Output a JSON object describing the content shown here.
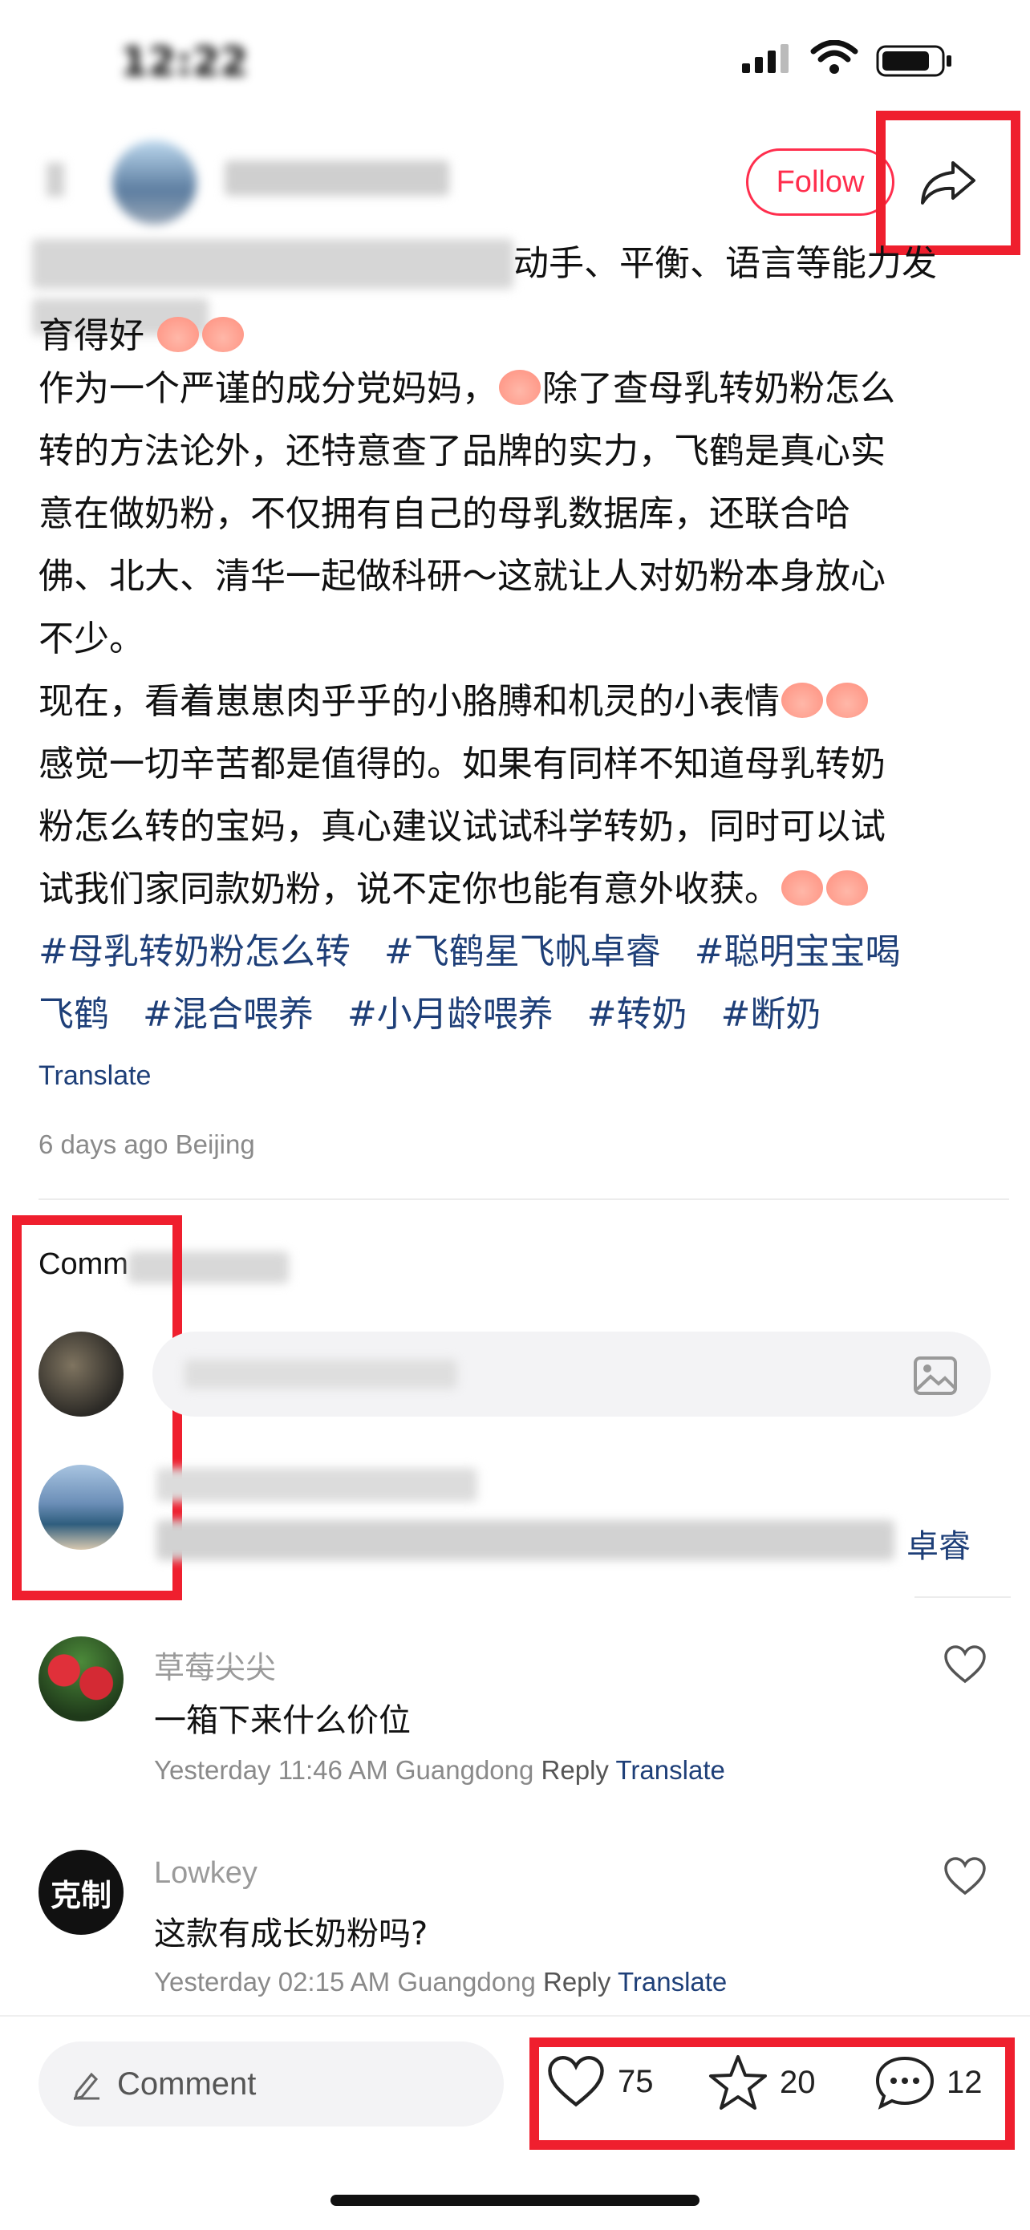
{
  "status": {
    "time": "12:22"
  },
  "header": {
    "follow_label": "Follow"
  },
  "post": {
    "line_0": "动手、平衡、语言等能力发",
    "line_1": "育得好",
    "line_2": "作为一个严谨的成分党妈妈，",
    "line_2b": "除了查母乳转奶粉怎么",
    "line_3": "转的方法论外，还特意查了品牌的实力，飞鹤是真心实",
    "line_4": "意在做奶粉，不仅拥有自己的母乳数据库，还联合哈",
    "line_5": "佛、北大、清华一起做科研～这就让人对奶粉本身放心",
    "line_6": "不少。",
    "line_7": "现在，看着崽崽肉乎乎的小胳膊和机灵的小表情",
    "line_8": "感觉一切辛苦都是值得的。如果有同样不知道母乳转奶",
    "line_9": "粉怎么转的宝妈，真心建议试试科学转奶，同时可以试",
    "line_10": "试我们家同款奶粉，说不定你也能有意外收获。",
    "tags": [
      "#母乳转奶粉怎么转",
      "#飞鹤星飞帆卓睿",
      "#聪明宝宝喝",
      "飞鹤",
      "#混合喂养",
      "#小月龄喂养",
      "#转奶",
      "#断奶"
    ],
    "translate": "Translate",
    "meta": "6 days ago Beijing"
  },
  "comments_section": {
    "title": "Comm",
    "pinned_tail": "卓睿",
    "items": [
      {
        "user": "草莓尖尖",
        "text": "一箱下来什么价位",
        "time": "Yesterday 11:46 AM Guangdong",
        "reply": "Reply",
        "translate": "Translate"
      },
      {
        "user": "Lowkey",
        "avatar_text": "克制",
        "text": "这款有成长奶粉吗?",
        "time": "Yesterday 02:15 AM Guangdong",
        "reply": "Reply",
        "translate": "Translate"
      }
    ]
  },
  "bottom": {
    "comment_placeholder": "Comment",
    "likes": "75",
    "stars": "20",
    "comments": "12"
  },
  "colors": {
    "accent": "#ff2e4d",
    "highlight": "#ef1f2e",
    "link": "#1e3f78"
  }
}
